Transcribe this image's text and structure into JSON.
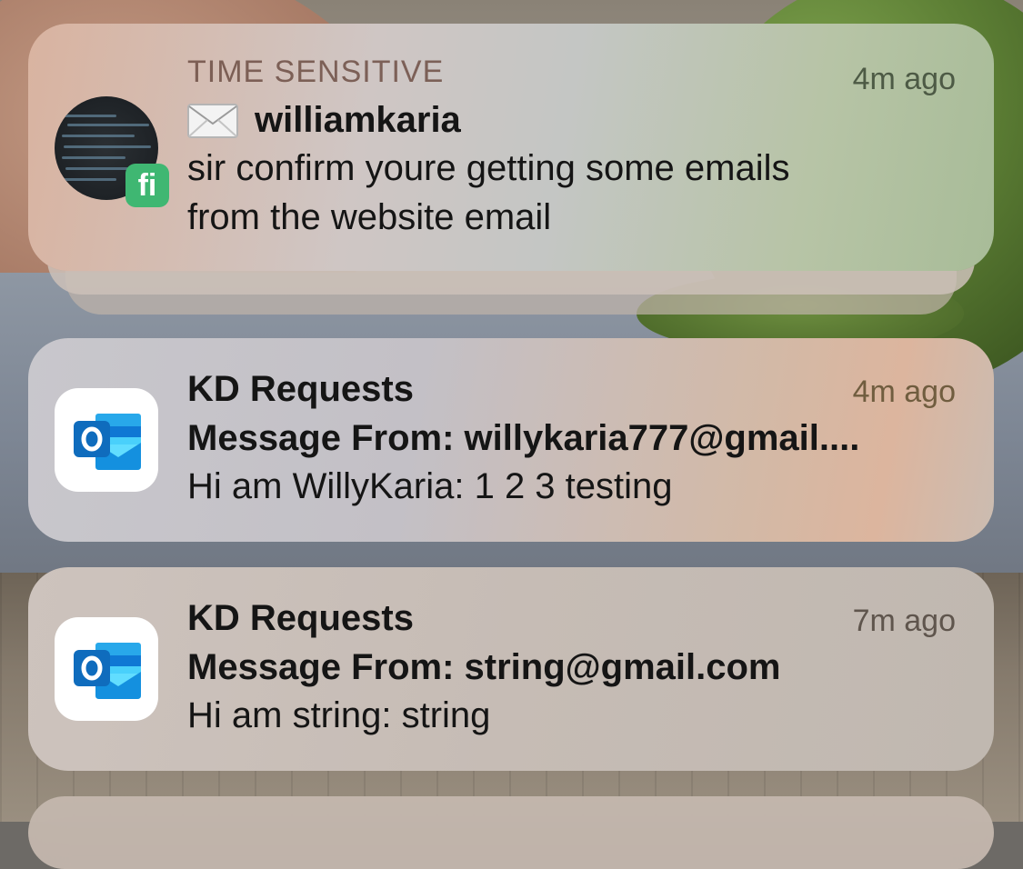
{
  "notifications": [
    {
      "label": "TIME SENSITIVE",
      "app_icon": "envelope-icon",
      "sender": "williamkaria",
      "time": "4m ago",
      "body_line1": "sir confirm youre getting some emails",
      "body_line2": "from the website email",
      "badge_letter": "fi",
      "badge_color": "#3fb772"
    },
    {
      "app": "KD Requests",
      "app_icon": "outlook-icon",
      "time": "4m ago",
      "subject": "Message From: willykaria777@gmail....",
      "preview": "Hi am WillyKaria: 1 2 3 testing"
    },
    {
      "app": "KD Requests",
      "app_icon": "outlook-icon",
      "time": "7m ago",
      "subject": "Message From: string@gmail.com",
      "preview": "Hi am string: string"
    }
  ],
  "colors": {
    "outlook_blue": "#0f6cbd",
    "outlook_light": "#28a8ea",
    "text_primary": "#151515"
  }
}
